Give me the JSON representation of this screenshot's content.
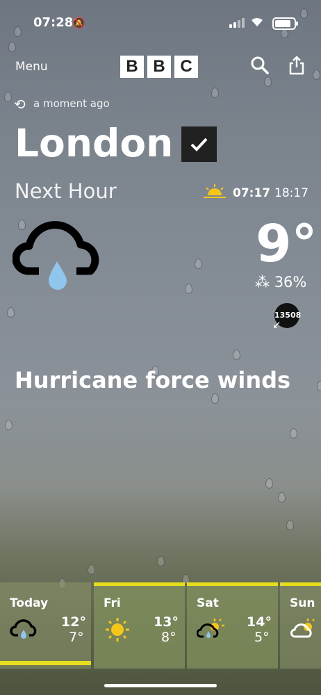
{
  "status": {
    "time": "07:28"
  },
  "header": {
    "menu_label": "Menu",
    "logo_letters": [
      "B",
      "B",
      "C"
    ]
  },
  "location": {
    "updated": "a moment ago",
    "city": "London"
  },
  "forecast": {
    "period": "Next Hour",
    "sunrise": "07:17",
    "sunset": "18:17",
    "temperature": "9°",
    "rain_chance": "36%",
    "badge": "13508",
    "headline": "Hurricane force winds"
  },
  "days": [
    {
      "day": "Today",
      "high": "12°",
      "low": "7°"
    },
    {
      "day": "Fri",
      "high": "13°",
      "low": "8°"
    },
    {
      "day": "Sat",
      "high": "14°",
      "low": "5°"
    },
    {
      "day": "Sun",
      "high": "",
      "low": ""
    }
  ],
  "colors": {
    "accent": "#e6de1d",
    "rain_drop": "#90c6ee"
  }
}
